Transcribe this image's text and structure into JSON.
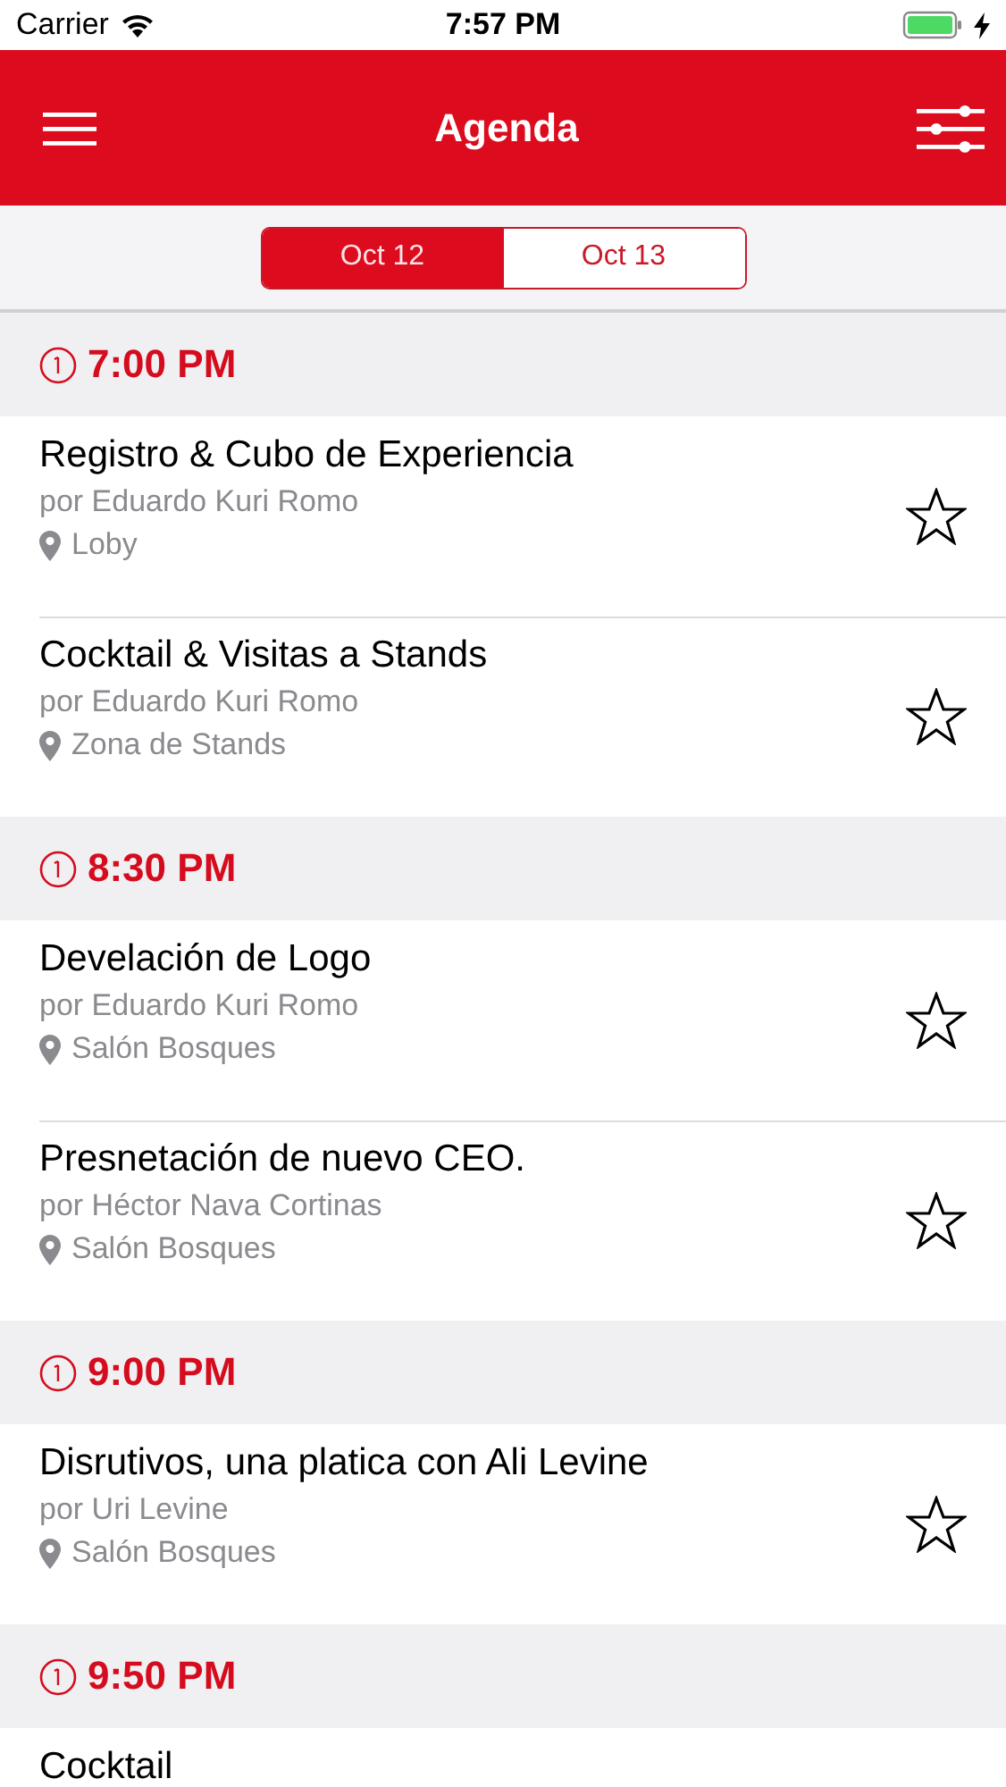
{
  "status_bar": {
    "carrier": "Carrier",
    "time": "7:57 PM",
    "charging": true
  },
  "nav": {
    "title": "Agenda"
  },
  "days": [
    {
      "label": "Oct 12",
      "selected": true
    },
    {
      "label": "Oct 13",
      "selected": false
    }
  ],
  "sections": [
    {
      "time": "7:00 PM",
      "items": [
        {
          "title": "Registro & Cubo de Experiencia",
          "speaker": "por Eduardo Kuri Romo",
          "location": "Loby",
          "starred": false
        },
        {
          "title": "Cocktail & Visitas a Stands",
          "speaker": "por Eduardo Kuri Romo",
          "location": "Zona de Stands",
          "starred": false
        }
      ]
    },
    {
      "time": "8:30 PM",
      "items": [
        {
          "title": "Develación de Logo",
          "speaker": "por Eduardo Kuri Romo",
          "location": "Salón Bosques",
          "starred": false
        },
        {
          "title": "Presnetación de nuevo CEO.",
          "speaker": "por Héctor Nava Cortinas",
          "location": "Salón Bosques",
          "starred": false
        }
      ]
    },
    {
      "time": "9:00 PM",
      "items": [
        {
          "title": "Disrutivos, una platica con Ali Levine",
          "speaker": "por Uri Levine",
          "location": "Salón Bosques",
          "starred": false
        }
      ]
    },
    {
      "time": "9:50 PM",
      "items": [
        {
          "title": "Cocktail"
        }
      ]
    }
  ]
}
